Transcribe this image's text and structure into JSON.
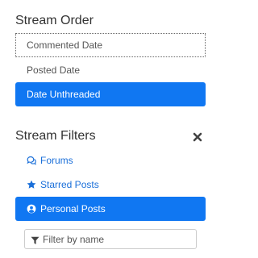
{
  "stream_order": {
    "title": "Stream Order",
    "options": [
      {
        "label": "Commented Date",
        "state": "focused"
      },
      {
        "label": "Posted Date",
        "state": "normal"
      },
      {
        "label": "Date Unthreaded",
        "state": "selected"
      }
    ]
  },
  "stream_filters": {
    "title": "Stream Filters",
    "close_icon": "close-icon",
    "items": [
      {
        "label": "Forums",
        "icon": "forums-icon",
        "state": "normal"
      },
      {
        "label": "Starred Posts",
        "icon": "star-icon",
        "state": "normal"
      },
      {
        "label": "Personal Posts",
        "icon": "user-circle-icon",
        "state": "selected"
      }
    ],
    "search": {
      "placeholder": "Filter by name",
      "value": "",
      "icon": "filter-icon"
    }
  },
  "colors": {
    "accent": "#1077f2",
    "link": "#1a6fd9",
    "text": "#333333"
  }
}
